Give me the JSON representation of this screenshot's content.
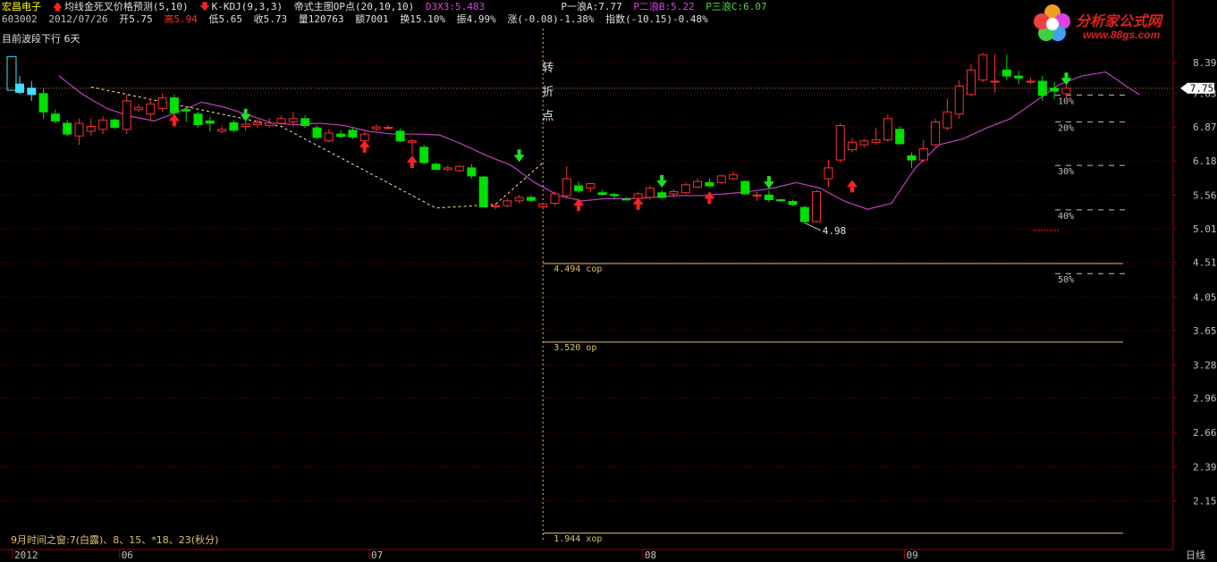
{
  "header": {
    "stock_name": "宏昌电子",
    "indicator1": "均线金死叉价格预测(5,10)",
    "indicator2": "K-KDJ(9,3,3)",
    "indicator3": "帝式主图OP点(20,10,10)",
    "d3x3": "D3X3:5.483",
    "wave_a": "P一浪A:7.77",
    "wave_b": "P二浪B:5.22",
    "wave_c": "P三浪C:6.07",
    "code": "603002",
    "date": "2012/07/26",
    "open": "开5.75",
    "high": "高5.94",
    "low": "低5.65",
    "close": "收5.73",
    "volume": "量120763",
    "amount": "额7001",
    "turnover": "换15.10%",
    "amplitude": "振4.99%",
    "change": "涨(-0.08)-1.38%",
    "index": "指数(-10.15)-0.48%",
    "trend_label": "目前波段下行 6天"
  },
  "logo": {
    "text": "分析家公式网",
    "url": "www.88gs.com"
  },
  "annotations": {
    "turn_point": [
      "转",
      "折",
      "点"
    ],
    "time_window": "9月时间之窗:7(白露)、8、15、*18、23(秋分)",
    "low_label": "4.98",
    "current_price": "7.75"
  },
  "colors": {
    "up": "#ff3030",
    "down": "#00e000",
    "ma": "#c040c0",
    "dotgrid": "#7a0000",
    "axis": "#a00000",
    "level": "#e0c070"
  },
  "chart_data": {
    "type": "candlestick",
    "period_label": "日线",
    "ylim": [
      1.9,
      8.75
    ],
    "y_ticks": [
      8.39,
      7.63,
      6.87,
      6.18,
      5.56,
      5.01,
      4.51,
      4.05,
      3.65,
      3.28,
      2.96,
      2.66,
      2.39,
      2.15
    ],
    "x_ticks": [
      {
        "label": "2012",
        "index": 0
      },
      {
        "label": "06",
        "index": 9
      },
      {
        "label": "07",
        "index": 30
      },
      {
        "label": "08",
        "index": 53
      },
      {
        "label": "09",
        "index": 75
      }
    ],
    "candles": [
      {
        "o": 7.85,
        "h": 8.05,
        "l": 7.6,
        "c": 7.65
      },
      {
        "o": 7.75,
        "h": 7.92,
        "l": 7.45,
        "c": 7.6
      },
      {
        "o": 7.62,
        "h": 7.75,
        "l": 7.05,
        "c": 7.2
      },
      {
        "o": 7.15,
        "h": 7.25,
        "l": 6.95,
        "c": 7.0
      },
      {
        "o": 6.95,
        "h": 7.02,
        "l": 6.68,
        "c": 6.72
      },
      {
        "o": 6.68,
        "h": 7.05,
        "l": 6.5,
        "c": 6.95
      },
      {
        "o": 6.78,
        "h": 7.05,
        "l": 6.68,
        "c": 6.88
      },
      {
        "o": 6.82,
        "h": 7.1,
        "l": 6.72,
        "c": 7.02
      },
      {
        "o": 7.02,
        "h": 7.05,
        "l": 6.82,
        "c": 6.86
      },
      {
        "o": 6.82,
        "h": 7.6,
        "l": 6.72,
        "c": 7.45
      },
      {
        "o": 7.25,
        "h": 7.38,
        "l": 7.2,
        "c": 7.3
      },
      {
        "o": 7.15,
        "h": 7.5,
        "l": 7.0,
        "c": 7.38
      },
      {
        "o": 7.28,
        "h": 7.62,
        "l": 7.2,
        "c": 7.52
      },
      {
        "o": 7.52,
        "h": 7.6,
        "l": 7.1,
        "c": 7.18
      },
      {
        "o": 7.25,
        "h": 7.3,
        "l": 6.98,
        "c": 7.22
      },
      {
        "o": 7.15,
        "h": 7.2,
        "l": 6.86,
        "c": 6.92
      },
      {
        "o": 7.0,
        "h": 7.1,
        "l": 6.78,
        "c": 6.95
      },
      {
        "o": 6.78,
        "h": 6.9,
        "l": 6.74,
        "c": 6.82
      },
      {
        "o": 6.96,
        "h": 7.02,
        "l": 6.76,
        "c": 6.8
      },
      {
        "o": 6.88,
        "h": 7.12,
        "l": 6.78,
        "c": 6.93
      },
      {
        "o": 6.92,
        "h": 7.02,
        "l": 6.85,
        "c": 6.96
      },
      {
        "o": 6.9,
        "h": 7.06,
        "l": 6.86,
        "c": 6.95
      },
      {
        "o": 6.95,
        "h": 7.12,
        "l": 6.9,
        "c": 7.05
      },
      {
        "o": 6.98,
        "h": 7.2,
        "l": 6.88,
        "c": 7.05
      },
      {
        "o": 7.05,
        "h": 7.12,
        "l": 6.85,
        "c": 6.9
      },
      {
        "o": 6.85,
        "h": 6.9,
        "l": 6.62,
        "c": 6.65
      },
      {
        "o": 6.58,
        "h": 6.82,
        "l": 6.55,
        "c": 6.74
      },
      {
        "o": 6.72,
        "h": 6.8,
        "l": 6.64,
        "c": 6.67
      },
      {
        "o": 6.8,
        "h": 6.85,
        "l": 6.62,
        "c": 6.66
      },
      {
        "o": 6.58,
        "h": 6.78,
        "l": 6.52,
        "c": 6.72
      },
      {
        "o": 6.83,
        "h": 6.92,
        "l": 6.78,
        "c": 6.87
      },
      {
        "o": 6.86,
        "h": 6.91,
        "l": 6.82,
        "c": 6.86
      },
      {
        "o": 6.78,
        "h": 6.84,
        "l": 6.55,
        "c": 6.58
      },
      {
        "o": 6.55,
        "h": 6.62,
        "l": 6.3,
        "c": 6.58
      },
      {
        "o": 6.45,
        "h": 6.5,
        "l": 6.12,
        "c": 6.15
      },
      {
        "o": 6.12,
        "h": 6.15,
        "l": 6.02,
        "c": 6.02
      },
      {
        "o": 6.02,
        "h": 6.1,
        "l": 5.98,
        "c": 6.05
      },
      {
        "o": 6.0,
        "h": 6.1,
        "l": 5.97,
        "c": 6.08
      },
      {
        "o": 6.05,
        "h": 6.12,
        "l": 5.85,
        "c": 5.9
      },
      {
        "o": 5.88,
        "h": 5.9,
        "l": 5.35,
        "c": 5.36
      },
      {
        "o": 5.36,
        "h": 5.42,
        "l": 5.32,
        "c": 5.38
      },
      {
        "o": 5.38,
        "h": 5.5,
        "l": 5.35,
        "c": 5.46
      },
      {
        "o": 5.46,
        "h": 5.56,
        "l": 5.42,
        "c": 5.52
      },
      {
        "o": 5.52,
        "h": 5.56,
        "l": 5.44,
        "c": 5.47
      },
      {
        "o": 5.36,
        "h": 5.42,
        "l": 5.32,
        "c": 5.41
      },
      {
        "o": 5.42,
        "h": 5.62,
        "l": 5.38,
        "c": 5.58
      },
      {
        "o": 5.55,
        "h": 6.08,
        "l": 5.5,
        "c": 5.85
      },
      {
        "o": 5.72,
        "h": 5.8,
        "l": 5.6,
        "c": 5.64
      },
      {
        "o": 5.68,
        "h": 5.78,
        "l": 5.62,
        "c": 5.76
      },
      {
        "o": 5.6,
        "h": 5.65,
        "l": 5.55,
        "c": 5.57
      },
      {
        "o": 5.57,
        "h": 5.6,
        "l": 5.5,
        "c": 5.55
      },
      {
        "o": 5.49,
        "h": 5.52,
        "l": 5.47,
        "c": 5.48
      },
      {
        "o": 5.5,
        "h": 5.62,
        "l": 5.48,
        "c": 5.58
      },
      {
        "o": 5.52,
        "h": 5.72,
        "l": 5.48,
        "c": 5.68
      },
      {
        "o": 5.6,
        "h": 5.65,
        "l": 5.5,
        "c": 5.52
      },
      {
        "o": 5.58,
        "h": 5.66,
        "l": 5.52,
        "c": 5.62
      },
      {
        "o": 5.6,
        "h": 5.78,
        "l": 5.58,
        "c": 5.74
      },
      {
        "o": 5.7,
        "h": 5.86,
        "l": 5.68,
        "c": 5.8
      },
      {
        "o": 5.78,
        "h": 5.85,
        "l": 5.7,
        "c": 5.72
      },
      {
        "o": 5.78,
        "h": 5.92,
        "l": 5.75,
        "c": 5.9
      },
      {
        "o": 5.85,
        "h": 5.98,
        "l": 5.82,
        "c": 5.92
      },
      {
        "o": 5.8,
        "h": 5.82,
        "l": 5.58,
        "c": 5.58
      },
      {
        "o": 5.56,
        "h": 5.62,
        "l": 5.46,
        "c": 5.56
      },
      {
        "o": 5.56,
        "h": 5.64,
        "l": 5.44,
        "c": 5.48
      },
      {
        "o": 5.48,
        "h": 5.5,
        "l": 5.44,
        "c": 5.46
      },
      {
        "o": 5.45,
        "h": 5.48,
        "l": 5.38,
        "c": 5.4
      },
      {
        "o": 5.35,
        "h": 5.38,
        "l": 5.1,
        "c": 5.12
      },
      {
        "o": 5.12,
        "h": 5.65,
        "l": 5.1,
        "c": 5.62
      },
      {
        "o": 5.85,
        "h": 6.2,
        "l": 5.7,
        "c": 6.05
      },
      {
        "o": 6.2,
        "h": 6.95,
        "l": 6.15,
        "c": 6.9
      },
      {
        "o": 6.4,
        "h": 6.65,
        "l": 6.35,
        "c": 6.55
      },
      {
        "o": 6.5,
        "h": 6.62,
        "l": 6.45,
        "c": 6.58
      },
      {
        "o": 6.55,
        "h": 6.85,
        "l": 6.5,
        "c": 6.6
      },
      {
        "o": 6.6,
        "h": 7.15,
        "l": 6.55,
        "c": 7.05
      },
      {
        "o": 6.82,
        "h": 6.88,
        "l": 6.52,
        "c": 6.52
      },
      {
        "o": 6.28,
        "h": 6.35,
        "l": 6.05,
        "c": 6.2
      },
      {
        "o": 6.2,
        "h": 6.6,
        "l": 6.15,
        "c": 6.42
      },
      {
        "o": 6.5,
        "h": 7.05,
        "l": 6.45,
        "c": 6.98
      },
      {
        "o": 6.85,
        "h": 7.5,
        "l": 6.8,
        "c": 7.2
      },
      {
        "o": 7.15,
        "h": 7.95,
        "l": 7.05,
        "c": 7.8
      },
      {
        "o": 7.6,
        "h": 8.35,
        "l": 7.55,
        "c": 8.2
      },
      {
        "o": 7.95,
        "h": 8.65,
        "l": 7.9,
        "c": 8.6
      },
      {
        "o": 7.9,
        "h": 8.62,
        "l": 7.65,
        "c": 7.92
      },
      {
        "o": 8.2,
        "h": 8.6,
        "l": 7.95,
        "c": 8.05
      },
      {
        "o": 8.05,
        "h": 8.18,
        "l": 7.85,
        "c": 8.0
      },
      {
        "o": 7.92,
        "h": 8.0,
        "l": 7.85,
        "c": 7.92
      },
      {
        "o": 7.92,
        "h": 8.05,
        "l": 7.45,
        "c": 7.58
      },
      {
        "o": 7.75,
        "h": 7.9,
        "l": 7.5,
        "c": 7.68
      },
      {
        "o": 7.62,
        "h": 7.88,
        "l": 7.5,
        "c": 7.75
      }
    ],
    "arrows": [
      {
        "index": 13,
        "dir": "up",
        "price": 7.0
      },
      {
        "index": 19,
        "dir": "down",
        "price": 7.15
      },
      {
        "index": 29,
        "dir": "up",
        "price": 6.45
      },
      {
        "index": 33,
        "dir": "up",
        "price": 6.15
      },
      {
        "index": 42,
        "dir": "down",
        "price": 6.3
      },
      {
        "index": 47,
        "dir": "up",
        "price": 5.38
      },
      {
        "index": 52,
        "dir": "up",
        "price": 5.4
      },
      {
        "index": 54,
        "dir": "down",
        "price": 5.82
      },
      {
        "index": 58,
        "dir": "up",
        "price": 5.5
      },
      {
        "index": 63,
        "dir": "down",
        "price": 5.8
      },
      {
        "index": 70,
        "dir": "up",
        "price": 5.7
      },
      {
        "index": 88,
        "dir": "down",
        "price": 8.0
      }
    ],
    "ma_line": [
      [
        0,
        8.05
      ],
      [
        2,
        7.6
      ],
      [
        4,
        7.28
      ],
      [
        6,
        7.1
      ],
      [
        8,
        7.0
      ],
      [
        10,
        7.2
      ],
      [
        12,
        7.42
      ],
      [
        14,
        7.3
      ],
      [
        16,
        7.12
      ],
      [
        18,
        6.95
      ],
      [
        20,
        6.92
      ],
      [
        22,
        6.95
      ],
      [
        24,
        6.9
      ],
      [
        26,
        6.78
      ],
      [
        28,
        6.72
      ],
      [
        30,
        6.72
      ],
      [
        32,
        6.7
      ],
      [
        34,
        6.5
      ],
      [
        36,
        6.28
      ],
      [
        38,
        6.1
      ],
      [
        40,
        5.78
      ],
      [
        42,
        5.55
      ],
      [
        44,
        5.46
      ],
      [
        46,
        5.5
      ],
      [
        48,
        5.5
      ],
      [
        50,
        5.52
      ],
      [
        52,
        5.55
      ],
      [
        54,
        5.55
      ],
      [
        56,
        5.58
      ],
      [
        58,
        5.62
      ],
      [
        60,
        5.68
      ],
      [
        62,
        5.78
      ],
      [
        64,
        5.68
      ],
      [
        66,
        5.46
      ],
      [
        68,
        5.32
      ],
      [
        70,
        5.42
      ],
      [
        72,
        6.05
      ],
      [
        74,
        6.5
      ],
      [
        76,
        6.62
      ],
      [
        78,
        6.85
      ],
      [
        80,
        7.05
      ],
      [
        82,
        7.42
      ],
      [
        84,
        7.82
      ],
      [
        86,
        8.05
      ],
      [
        88,
        8.15
      ],
      [
        90,
        7.75
      ]
    ],
    "ma_line_end": 91,
    "wave_dashed": [
      [
        6,
        7.78
      ],
      [
        22,
        6.88
      ],
      [
        35,
        5.34
      ],
      [
        40,
        5.4
      ],
      [
        44,
        6.15
      ]
    ],
    "levels": [
      {
        "price": 4.494,
        "label": "4.494 cop"
      },
      {
        "price": 3.52,
        "label": "3.520  op"
      },
      {
        "price": 1.944,
        "label": "1.944 xop"
      }
    ],
    "retracements": [
      {
        "price": 7.63,
        "label": "10%"
      },
      {
        "price": 7.02,
        "label": "20%"
      },
      {
        "price": 6.13,
        "label": "30%"
      },
      {
        "price": 5.34,
        "label": "40%"
      },
      {
        "price": 4.38,
        "label": "50%"
      }
    ],
    "turn_index": 44,
    "current_price": 7.75
  }
}
